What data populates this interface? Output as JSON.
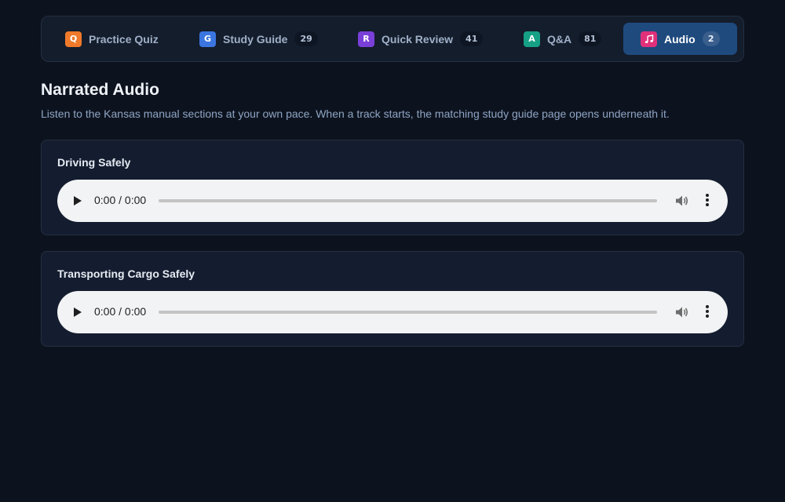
{
  "tabs": [
    {
      "icon": "Q",
      "label": "Practice Quiz",
      "count": null,
      "color": "#f07a2a"
    },
    {
      "icon": "G",
      "label": "Study Guide",
      "count": "29",
      "color": "#3b76e0"
    },
    {
      "icon": "R",
      "label": "Quick Review",
      "count": "41",
      "color": "#7a3fd8"
    },
    {
      "icon": "A",
      "label": "Q&A",
      "count": "81",
      "color": "#16a085"
    },
    {
      "icon": "music-note-icon",
      "label": "Audio",
      "count": "2",
      "color": "#e0307a",
      "active": true
    }
  ],
  "page": {
    "title": "Narrated Audio",
    "subtitle": "Listen to the Kansas manual sections at your own pace. When a track starts, the matching study guide page opens underneath it."
  },
  "tracks": [
    {
      "title": "Driving Safely",
      "time": "0:00 / 0:00"
    },
    {
      "title": "Transporting Cargo Safely",
      "time": "0:00 / 0:00"
    }
  ]
}
